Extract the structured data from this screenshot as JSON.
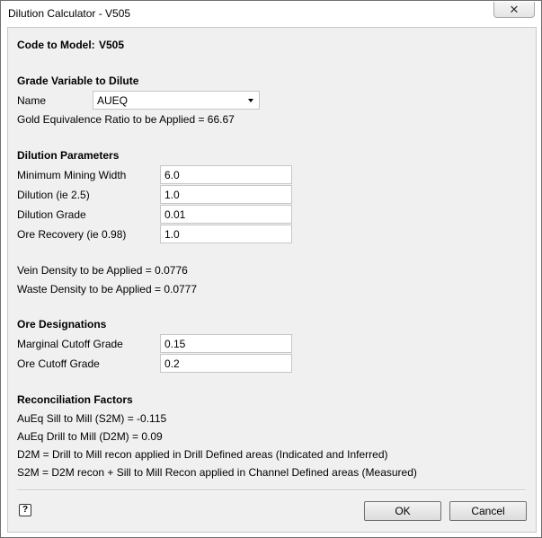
{
  "window": {
    "title": "Dilution Calculator - V505",
    "close_glyph": "✕"
  },
  "code_to_model": {
    "label": "Code to Model:",
    "value": "V505"
  },
  "grade_variable": {
    "heading": "Grade Variable to Dilute",
    "name_label": "Name",
    "name_value": "AUEQ",
    "ratio_text": "Gold Equivalence Ratio to be Applied = 66.67"
  },
  "dilution_parameters": {
    "heading": "Dilution Parameters",
    "fields": [
      {
        "label": "Minimum Mining Width",
        "value": "6.0"
      },
      {
        "label": "Dilution (ie 2.5)",
        "value": "1.0"
      },
      {
        "label": "Dilution Grade",
        "value": "0.01"
      },
      {
        "label": "Ore Recovery (ie 0.98)",
        "value": "1.0"
      }
    ],
    "vein_density": "Vein Density to be Applied = 0.0776",
    "waste_density": "Waste Density to be Applied = 0.0777"
  },
  "ore_designations": {
    "heading": "Ore Designations",
    "fields": [
      {
        "label": "Marginal Cutoff Grade",
        "value": "0.15"
      },
      {
        "label": "Ore Cutoff Grade",
        "value": "0.2"
      }
    ]
  },
  "reconciliation": {
    "heading": "Reconciliation Factors",
    "lines": [
      "AuEq Sill to Mill (S2M) = -0.115",
      "AuEq Drill to Mill (D2M) = 0.09",
      "D2M = Drill to Mill recon applied in Drill Defined areas (Indicated and Inferred)",
      "S2M = D2M recon + Sill to Mill Recon applied in Channel Defined areas (Measured)"
    ]
  },
  "buttons": {
    "ok": "OK",
    "cancel": "Cancel",
    "help_glyph": "?"
  }
}
